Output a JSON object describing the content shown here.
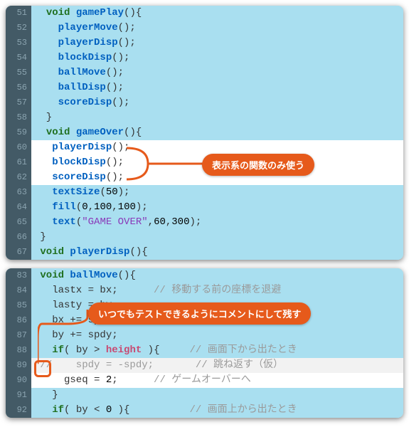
{
  "block1": {
    "lines": [
      {
        "n": 51,
        "hl": false,
        "parts": [
          {
            "t": "  ",
            "c": ""
          },
          {
            "t": "void",
            "c": "kw"
          },
          {
            "t": " ",
            "c": ""
          },
          {
            "t": "gamePlay",
            "c": "fn"
          },
          {
            "t": "(){",
            "c": "brace"
          }
        ]
      },
      {
        "n": 52,
        "hl": false,
        "parts": [
          {
            "t": "    ",
            "c": ""
          },
          {
            "t": "playerMove",
            "c": "fn"
          },
          {
            "t": "();",
            "c": "op"
          }
        ]
      },
      {
        "n": 53,
        "hl": false,
        "parts": [
          {
            "t": "    ",
            "c": ""
          },
          {
            "t": "playerDisp",
            "c": "fn"
          },
          {
            "t": "();",
            "c": "op"
          }
        ]
      },
      {
        "n": 54,
        "hl": false,
        "parts": [
          {
            "t": "    ",
            "c": ""
          },
          {
            "t": "blockDisp",
            "c": "fn"
          },
          {
            "t": "();",
            "c": "op"
          }
        ]
      },
      {
        "n": 55,
        "hl": false,
        "parts": [
          {
            "t": "    ",
            "c": ""
          },
          {
            "t": "ballMove",
            "c": "fn"
          },
          {
            "t": "();",
            "c": "op"
          }
        ]
      },
      {
        "n": 56,
        "hl": false,
        "parts": [
          {
            "t": "    ",
            "c": ""
          },
          {
            "t": "ballDisp",
            "c": "fn"
          },
          {
            "t": "();",
            "c": "op"
          }
        ]
      },
      {
        "n": 57,
        "hl": false,
        "parts": [
          {
            "t": "    ",
            "c": ""
          },
          {
            "t": "scoreDisp",
            "c": "fn"
          },
          {
            "t": "();",
            "c": "op"
          }
        ]
      },
      {
        "n": 58,
        "hl": false,
        "parts": [
          {
            "t": "  }",
            "c": "brace"
          }
        ]
      },
      {
        "n": 59,
        "hl": false,
        "parts": [
          {
            "t": "  ",
            "c": ""
          },
          {
            "t": "void",
            "c": "kw"
          },
          {
            "t": " ",
            "c": ""
          },
          {
            "t": "gameOver",
            "c": "fn"
          },
          {
            "t": "(){",
            "c": "brace"
          }
        ]
      },
      {
        "n": 60,
        "hl": true,
        "parts": [
          {
            "t": "   ",
            "c": ""
          },
          {
            "t": "playerDisp",
            "c": "fn"
          },
          {
            "t": "();",
            "c": "op"
          }
        ]
      },
      {
        "n": 61,
        "hl": true,
        "parts": [
          {
            "t": "   ",
            "c": ""
          },
          {
            "t": "blockDisp",
            "c": "fn"
          },
          {
            "t": "();",
            "c": "op"
          }
        ]
      },
      {
        "n": 62,
        "hl": true,
        "parts": [
          {
            "t": "   ",
            "c": ""
          },
          {
            "t": "scoreDisp",
            "c": "fn"
          },
          {
            "t": "();",
            "c": "op"
          }
        ]
      },
      {
        "n": 63,
        "hl": false,
        "parts": [
          {
            "t": "   ",
            "c": ""
          },
          {
            "t": "textSize",
            "c": "builtin"
          },
          {
            "t": "(",
            "c": "op"
          },
          {
            "t": "50",
            "c": "num"
          },
          {
            "t": ");",
            "c": "op"
          }
        ]
      },
      {
        "n": 64,
        "hl": false,
        "parts": [
          {
            "t": "   ",
            "c": ""
          },
          {
            "t": "fill",
            "c": "builtin"
          },
          {
            "t": "(",
            "c": "op"
          },
          {
            "t": "0",
            "c": "num"
          },
          {
            "t": ",",
            "c": "op"
          },
          {
            "t": "100",
            "c": "num"
          },
          {
            "t": ",",
            "c": "op"
          },
          {
            "t": "100",
            "c": "num"
          },
          {
            "t": ");",
            "c": "op"
          }
        ]
      },
      {
        "n": 65,
        "hl": false,
        "parts": [
          {
            "t": "   ",
            "c": ""
          },
          {
            "t": "text",
            "c": "builtin"
          },
          {
            "t": "(",
            "c": "op"
          },
          {
            "t": "\"GAME OVER\"",
            "c": "str"
          },
          {
            "t": ",",
            "c": "op"
          },
          {
            "t": "60",
            "c": "num"
          },
          {
            "t": ",",
            "c": "op"
          },
          {
            "t": "300",
            "c": "num"
          },
          {
            "t": ");",
            "c": "op"
          }
        ]
      },
      {
        "n": 66,
        "hl": false,
        "parts": [
          {
            "t": " }",
            "c": "brace"
          }
        ]
      },
      {
        "n": 67,
        "hl": false,
        "parts": [
          {
            "t": " ",
            "c": ""
          },
          {
            "t": "void",
            "c": "kw"
          },
          {
            "t": " ",
            "c": ""
          },
          {
            "t": "playerDisp",
            "c": "fn"
          },
          {
            "t": "(){",
            "c": "brace"
          }
        ]
      }
    ],
    "callout": "表示系の関数のみ使う"
  },
  "block2": {
    "lines": [
      {
        "n": 83,
        "hl": false,
        "parts": [
          {
            "t": " ",
            "c": ""
          },
          {
            "t": "void",
            "c": "kw"
          },
          {
            "t": " ",
            "c": ""
          },
          {
            "t": "ballMove",
            "c": "fn"
          },
          {
            "t": "(){",
            "c": "brace"
          }
        ]
      },
      {
        "n": 84,
        "hl": false,
        "parts": [
          {
            "t": "   lastx = bx;      ",
            "c": ""
          },
          {
            "t": "// 移動する前の座標を退避",
            "c": "comment"
          }
        ]
      },
      {
        "n": 85,
        "hl": false,
        "parts": [
          {
            "t": "   lasty = by",
            "c": ""
          }
        ]
      },
      {
        "n": 86,
        "hl": false,
        "parts": [
          {
            "t": "   bx += spdx;",
            "c": ""
          }
        ]
      },
      {
        "n": 87,
        "hl": false,
        "parts": [
          {
            "t": "   by += spdy;",
            "c": ""
          }
        ]
      },
      {
        "n": 88,
        "hl": false,
        "parts": [
          {
            "t": "   ",
            "c": ""
          },
          {
            "t": "if",
            "c": "kw"
          },
          {
            "t": "( by > ",
            "c": ""
          },
          {
            "t": "height",
            "c": "sys"
          },
          {
            "t": " ){     ",
            "c": ""
          },
          {
            "t": "// 画面下から出たとき",
            "c": "comment"
          }
        ]
      },
      {
        "n": 89,
        "hl": "hl2",
        "parts": [
          {
            "t": " //    spdy = -spdy;       ",
            "c": "comment"
          },
          {
            "t": "// 跳ね返す（仮）",
            "c": "comment"
          }
        ]
      },
      {
        "n": 90,
        "hl": true,
        "parts": [
          {
            "t": "     gseq = ",
            "c": ""
          },
          {
            "t": "2",
            "c": "num"
          },
          {
            "t": ";      ",
            "c": ""
          },
          {
            "t": "// ゲームオーバーへ",
            "c": "comment"
          }
        ]
      },
      {
        "n": 91,
        "hl": false,
        "parts": [
          {
            "t": "   }",
            "c": "brace"
          }
        ]
      },
      {
        "n": 92,
        "hl": false,
        "parts": [
          {
            "t": "   ",
            "c": ""
          },
          {
            "t": "if",
            "c": "kw"
          },
          {
            "t": "( by < ",
            "c": ""
          },
          {
            "t": "0",
            "c": "num"
          },
          {
            "t": " ){          ",
            "c": ""
          },
          {
            "t": "// 画面上から出たとき",
            "c": "comment"
          }
        ]
      }
    ],
    "callout": "いつでもテストできるようにコメントにして残す"
  }
}
